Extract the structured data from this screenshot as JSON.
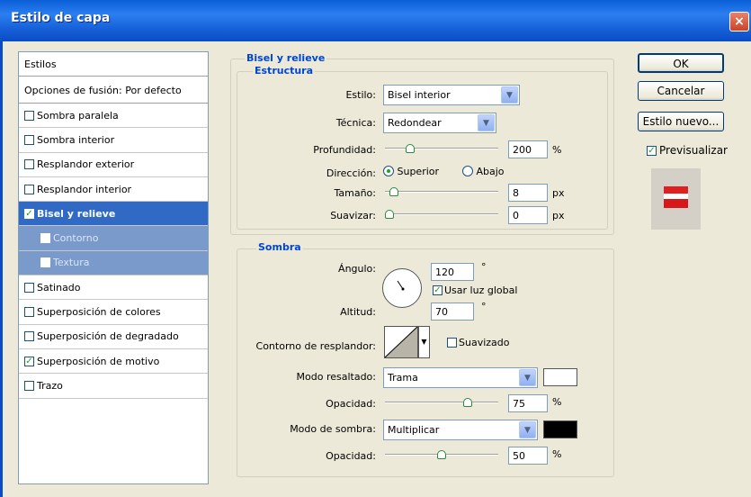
{
  "window": {
    "title": "Estilo de capa",
    "close_glyph": "×"
  },
  "styles_panel": {
    "header": "Estilos",
    "blend_options": "Opciones de fusión: Por defecto",
    "items": [
      {
        "label": "Sombra paralela",
        "checked": false
      },
      {
        "label": "Sombra interior",
        "checked": false
      },
      {
        "label": "Resplandor exterior",
        "checked": false
      },
      {
        "label": "Resplandor interior",
        "checked": false
      },
      {
        "label": "Bisel y relieve",
        "checked": true,
        "selected": true
      },
      {
        "label": "Contorno",
        "checked": false,
        "sub": true
      },
      {
        "label": "Textura",
        "checked": false,
        "sub": true
      },
      {
        "label": "Satinado",
        "checked": false
      },
      {
        "label": "Superposición de colores",
        "checked": false
      },
      {
        "label": "Superposición de degradado",
        "checked": false
      },
      {
        "label": "Superposición de motivo",
        "checked": true
      },
      {
        "label": "Trazo",
        "checked": false
      }
    ]
  },
  "bevel": {
    "title": "Bisel y relieve",
    "structure_title": "Estructura",
    "style_label": "Estilo:",
    "style_value": "Bisel interior",
    "technique_label": "Técnica:",
    "technique_value": "Redondear",
    "depth_label": "Profundidad:",
    "depth_value": "200",
    "depth_unit": "%",
    "depth_slider": 0.2,
    "direction_label": "Dirección:",
    "direction_up": "Superior",
    "direction_down": "Abajo",
    "direction_selected": "Superior",
    "size_label": "Tamaño:",
    "size_value": "8",
    "size_unit": "px",
    "size_slider": 0.04,
    "soften_label": "Suavizar:",
    "soften_value": "0",
    "soften_unit": "px",
    "soften_slider": 0.0
  },
  "shading": {
    "title": "Sombra",
    "angle_label": "Ángulo:",
    "angle_value": "120",
    "angle_unit": "°",
    "global_light_label": "Usar luz global",
    "global_light_checked": true,
    "altitude_label": "Altitud:",
    "altitude_value": "70",
    "altitude_unit": "°",
    "gloss_contour_label": "Contorno de resplandor:",
    "antialiased_label": "Suavizado",
    "antialiased_checked": false,
    "highlight_mode_label": "Modo resaltado:",
    "highlight_mode_value": "Trama",
    "highlight_color": "#ffffff",
    "highlight_opacity_label": "Opacidad:",
    "highlight_opacity_value": "75",
    "highlight_opacity_unit": "%",
    "highlight_opacity_slider": 0.75,
    "shadow_mode_label": "Modo de sombra:",
    "shadow_mode_value": "Multiplicar",
    "shadow_color": "#000000",
    "shadow_opacity_label": "Opacidad:",
    "shadow_opacity_value": "50",
    "shadow_opacity_unit": "%",
    "shadow_opacity_slider": 0.5
  },
  "buttons": {
    "ok": "OK",
    "cancel": "Cancelar",
    "new_style": "Estilo nuevo...",
    "preview_label": "Previsualizar",
    "preview_checked": true
  },
  "colors": {
    "accent": "#316ac5",
    "title_blue": "#0046d5",
    "titlebar": "#0a5fd8"
  }
}
